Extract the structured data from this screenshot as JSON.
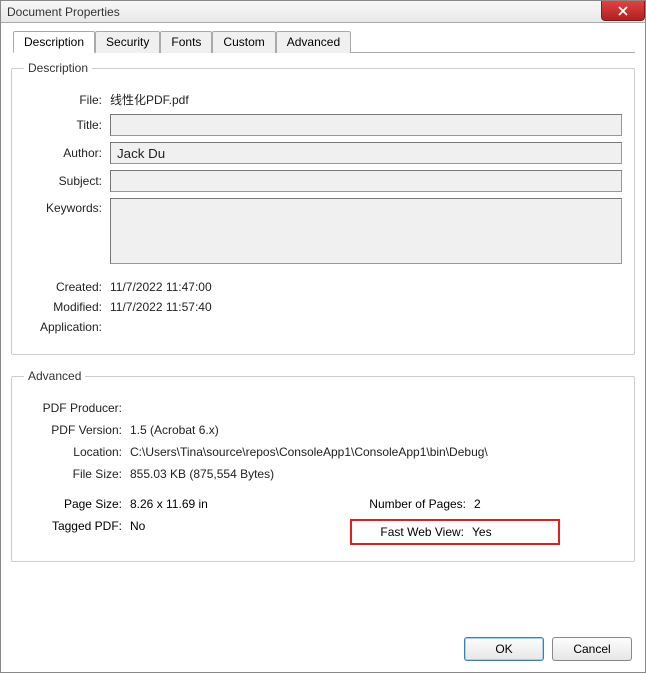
{
  "window": {
    "title": "Document Properties"
  },
  "tabs": {
    "description": "Description",
    "security": "Security",
    "fonts": "Fonts",
    "custom": "Custom",
    "advanced": "Advanced"
  },
  "description_group": {
    "legend": "Description",
    "file_label": "File:",
    "file_value": "线性化PDF.pdf",
    "title_label": "Title:",
    "title_value": "",
    "author_label": "Author:",
    "author_value": "Jack Du",
    "subject_label": "Subject:",
    "subject_value": "",
    "keywords_label": "Keywords:",
    "keywords_value": "",
    "created_label": "Created:",
    "created_value": "11/7/2022 11:47:00",
    "modified_label": "Modified:",
    "modified_value": "11/7/2022 11:57:40",
    "application_label": "Application:",
    "application_value": ""
  },
  "advanced_group": {
    "legend": "Advanced",
    "producer_label": "PDF Producer:",
    "producer_value": "",
    "version_label": "PDF Version:",
    "version_value": "1.5 (Acrobat 6.x)",
    "location_label": "Location:",
    "location_value": "C:\\Users\\Tina\\source\\repos\\ConsoleApp1\\ConsoleApp1\\bin\\Debug\\",
    "filesize_label": "File Size:",
    "filesize_value": "855.03 KB (875,554 Bytes)",
    "pagesize_label": "Page Size:",
    "pagesize_value": "8.26 x 11.69 in",
    "numpages_label": "Number of Pages:",
    "numpages_value": "2",
    "tagged_label": "Tagged PDF:",
    "tagged_value": "No",
    "fastweb_label": "Fast Web View:",
    "fastweb_value": "Yes"
  },
  "buttons": {
    "ok": "OK",
    "cancel": "Cancel"
  }
}
